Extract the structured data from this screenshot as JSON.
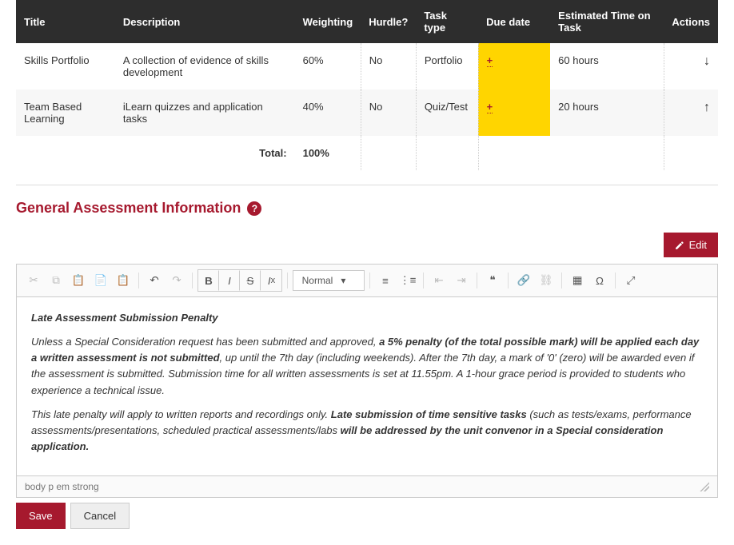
{
  "table": {
    "headers": {
      "title": "Title",
      "description": "Description",
      "weighting": "Weighting",
      "hurdle": "Hurdle?",
      "task_type": "Task type",
      "due_date": "Due date",
      "est_time": "Estimated Time on Task",
      "actions": "Actions"
    },
    "rows": [
      {
        "title": "Skills Portfolio",
        "description": "A collection of evidence of skills development",
        "weighting": "60%",
        "hurdle": "No",
        "task_type": "Portfolio",
        "due_icon": "+",
        "est_time": "60 hours",
        "action_icon": "↓"
      },
      {
        "title": "Team Based Learning",
        "description": "iLearn quizzes and application tasks",
        "weighting": "40%",
        "hurdle": "No",
        "task_type": "Quiz/Test",
        "due_icon": "+",
        "est_time": "20 hours",
        "action_icon": "↑"
      }
    ],
    "total_label": "Total:",
    "total_value": "100%"
  },
  "section_heading": "General Assessment Information",
  "help_glyph": "?",
  "edit_button": "Edit",
  "toolbar": {
    "format_label": "Normal"
  },
  "content": {
    "heading": "Late Assessment Submission Penalty",
    "p1_a": "Unless a Special Consideration request has been submitted and approved, ",
    "p1_b": "a 5% penalty (of the total possible mark) will be applied each day a written assessment is not submitted",
    "p1_c": ", up until the 7th day (including weekends). After the 7th day, a mark of '0' (zero) will be awarded even if the assessment is submitted. Submission time for all written assessments is set at 11.55pm. A 1-hour grace period is provided to students who experience a technical issue.",
    "p2_a": "This late penalty will apply to written reports and recordings only. ",
    "p2_b": "Late submission of time sensitive tasks",
    "p2_c": " (such as tests/exams, performance assessments/presentations, scheduled practical assessments/labs ",
    "p2_d": "will be addressed by the unit convenor in a Special consideration application."
  },
  "path_bar": "body   p   em   strong",
  "save_button": "Save",
  "cancel_button": "Cancel"
}
